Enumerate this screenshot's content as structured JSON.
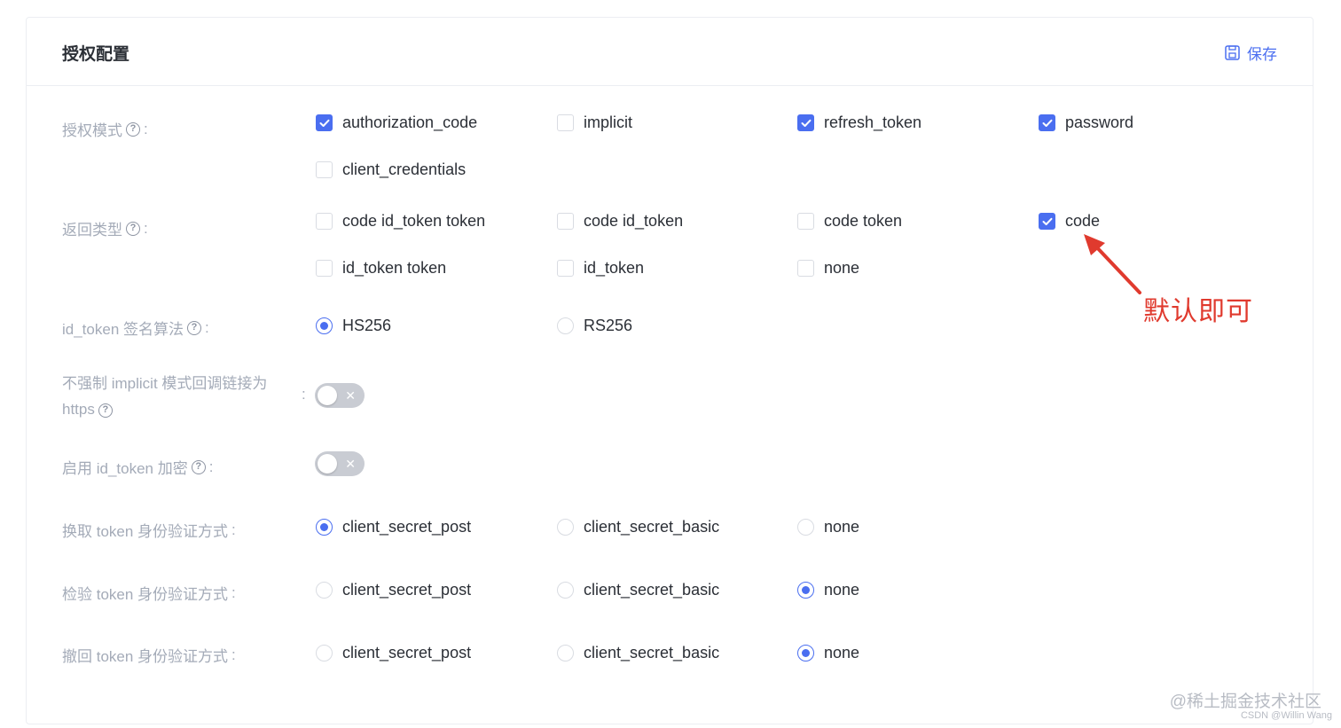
{
  "header": {
    "title": "授权配置",
    "save_label": "保存"
  },
  "colors": {
    "accent": "#4a6ef0",
    "label": "#a4abb8",
    "text": "#2b2f36",
    "annotation": "#e03a2e"
  },
  "grant_types": {
    "label": "授权模式",
    "options": [
      {
        "label": "authorization_code",
        "checked": true
      },
      {
        "label": "implicit",
        "checked": false
      },
      {
        "label": "refresh_token",
        "checked": true
      },
      {
        "label": "password",
        "checked": true
      },
      {
        "label": "client_credentials",
        "checked": false
      }
    ]
  },
  "response_types": {
    "label": "返回类型",
    "options": [
      {
        "label": "code id_token token",
        "checked": false
      },
      {
        "label": "code id_token",
        "checked": false
      },
      {
        "label": "code token",
        "checked": false
      },
      {
        "label": "code",
        "checked": true
      },
      {
        "label": "id_token token",
        "checked": false
      },
      {
        "label": "id_token",
        "checked": false
      },
      {
        "label": "none",
        "checked": false
      }
    ]
  },
  "id_token_alg": {
    "label": "id_token 签名算法",
    "options": [
      {
        "label": "HS256",
        "selected": true
      },
      {
        "label": "RS256",
        "selected": false
      }
    ]
  },
  "implicit_https": {
    "label": "不强制 implicit 模式回调链接为 https",
    "enabled": false
  },
  "id_token_encrypt": {
    "label": "启用 id_token 加密",
    "enabled": false
  },
  "token_auth": {
    "label": "换取 token 身份验证方式",
    "options": [
      {
        "label": "client_secret_post",
        "selected": true
      },
      {
        "label": "client_secret_basic",
        "selected": false
      },
      {
        "label": "none",
        "selected": false
      }
    ]
  },
  "introspection_auth": {
    "label": "检验 token 身份验证方式",
    "options": [
      {
        "label": "client_secret_post",
        "selected": false
      },
      {
        "label": "client_secret_basic",
        "selected": false
      },
      {
        "label": "none",
        "selected": true
      }
    ]
  },
  "revocation_auth": {
    "label": "撤回 token 身份验证方式",
    "options": [
      {
        "label": "client_secret_post",
        "selected": false
      },
      {
        "label": "client_secret_basic",
        "selected": false
      },
      {
        "label": "none",
        "selected": true
      }
    ]
  },
  "annotation": {
    "text": "默认即可"
  },
  "watermark": {
    "line1": "@稀土掘金技术社区",
    "line2": "CSDN @Willin Wang"
  }
}
